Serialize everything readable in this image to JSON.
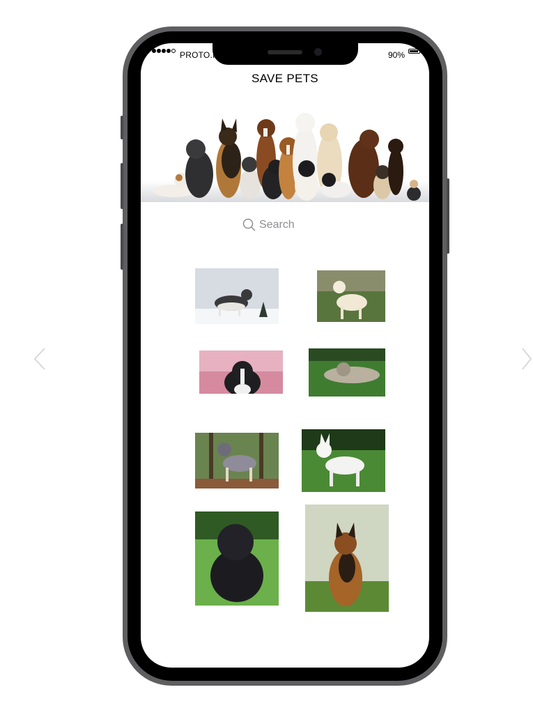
{
  "status_bar": {
    "carrier": "PROTO.IO",
    "battery": "90%",
    "battery_level": 0.9,
    "signal_bars": 4
  },
  "app": {
    "title": "SAVE PETS"
  },
  "hero": {
    "icon": "dog-group-banner"
  },
  "search": {
    "placeholder": "Search",
    "icon": "search-icon"
  },
  "pets": [
    {
      "icon": "husky-photo"
    },
    {
      "icon": "golden-retriever-photo"
    },
    {
      "icon": "border-collie-photo"
    },
    {
      "icon": "keeshond-photo"
    },
    {
      "icon": "australian-shepherd-photo"
    },
    {
      "icon": "white-shepherd-photo"
    },
    {
      "icon": "newfoundland-puppy-photo"
    },
    {
      "icon": "german-shepherd-photo"
    }
  ],
  "navigation": {
    "prev_icon": "chevron-left-icon",
    "next_icon": "chevron-right-icon"
  },
  "colors": {
    "frame": "#5f5f61",
    "bezel": "#000000",
    "arrow": "#d9d9d9",
    "placeholder": "#8e8e93"
  }
}
